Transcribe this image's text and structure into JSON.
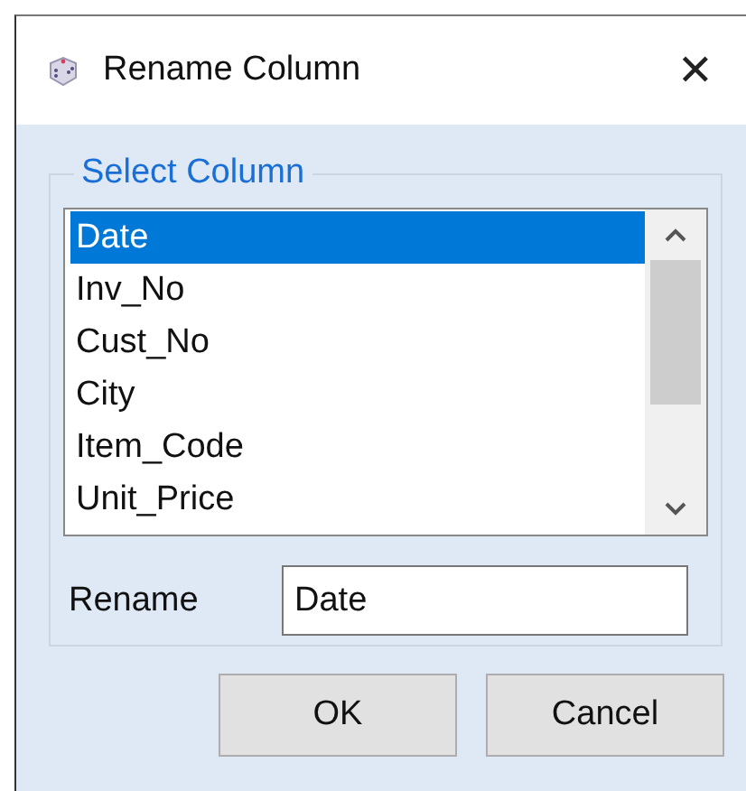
{
  "window": {
    "title": "Rename Column",
    "close": "✕"
  },
  "group": {
    "title": "Select Column"
  },
  "columns": [
    {
      "name": "Date",
      "selected": true
    },
    {
      "name": "Inv_No",
      "selected": false
    },
    {
      "name": "Cust_No",
      "selected": false
    },
    {
      "name": "City",
      "selected": false
    },
    {
      "name": "Item_Code",
      "selected": false
    },
    {
      "name": "Unit_Price",
      "selected": false
    }
  ],
  "rename": {
    "label": "Rename",
    "value": "Date"
  },
  "buttons": [
    "OK",
    "Cancel"
  ]
}
